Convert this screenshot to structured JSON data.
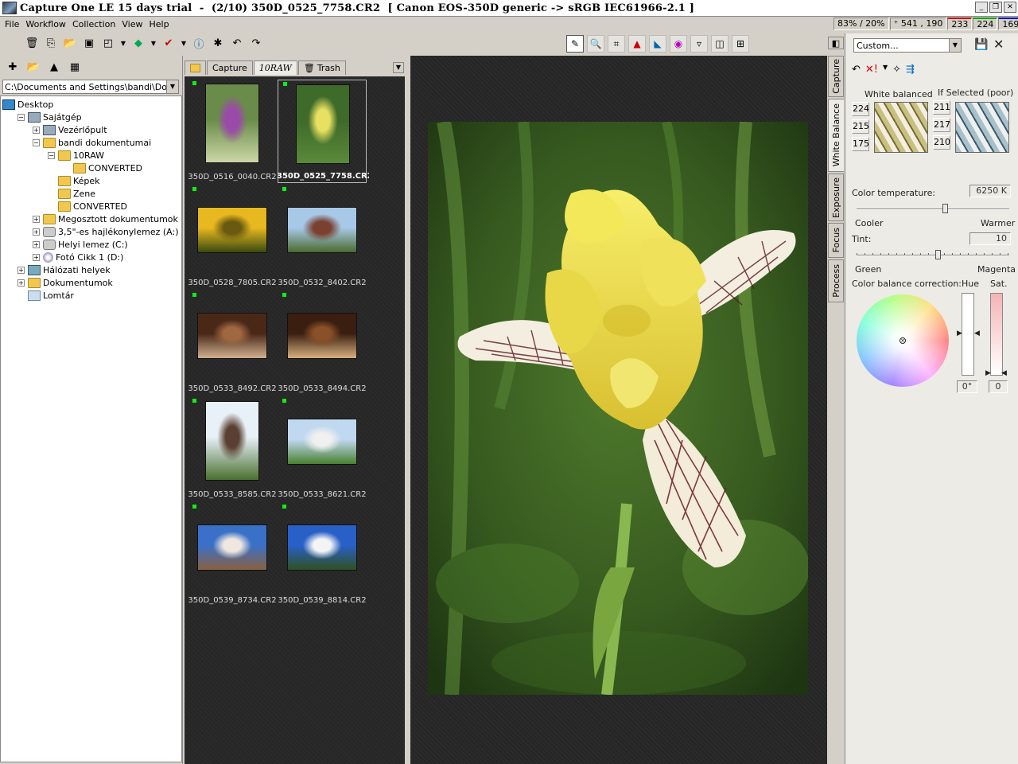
{
  "window": {
    "title": "Capture One LE 15 days trial  -  (2/10) 350D_0525_7758.CR2  [ Canon EOS-350D generic -> sRGB IEC61966-2.1 ]"
  },
  "menu": [
    "File",
    "Workflow",
    "Collection",
    "View",
    "Help"
  ],
  "status": {
    "zoom": "83% / 20%",
    "coords": "541 , 190",
    "r": "233",
    "g": "224",
    "b": "169"
  },
  "folder_path": "C:\\Documents and Settings\\bandi\\Dokumentumai",
  "tree": [
    {
      "label": "Desktop",
      "indent": 0,
      "expander": "",
      "icon": "desk"
    },
    {
      "label": "Sajátgép",
      "indent": 1,
      "expander": "−",
      "icon": "pc"
    },
    {
      "label": "Vezérlőpult",
      "indent": 2,
      "expander": "+",
      "icon": "pc"
    },
    {
      "label": "bandi dokumentumai",
      "indent": 2,
      "expander": "−",
      "icon": "folder"
    },
    {
      "label": "10RAW",
      "indent": 3,
      "expander": "−",
      "icon": "folder"
    },
    {
      "label": "CONVERTED",
      "indent": 4,
      "expander": "",
      "icon": "folder"
    },
    {
      "label": "Képek",
      "indent": 3,
      "expander": "",
      "icon": "folder"
    },
    {
      "label": "Zene",
      "indent": 3,
      "expander": "",
      "icon": "folder"
    },
    {
      "label": "CONVERTED",
      "indent": 3,
      "expander": "",
      "icon": "folder"
    },
    {
      "label": "Megosztott dokumentumok",
      "indent": 2,
      "expander": "+",
      "icon": "folder"
    },
    {
      "label": "3,5\"-es hajlékonylemez (A:)",
      "indent": 2,
      "expander": "+",
      "icon": "drive"
    },
    {
      "label": "Helyi lemez (C:)",
      "indent": 2,
      "expander": "+",
      "icon": "drive"
    },
    {
      "label": "Fotó Cikk 1 (D:)",
      "indent": 2,
      "expander": "+",
      "icon": "cd"
    },
    {
      "label": "Hálózati helyek",
      "indent": 1,
      "expander": "+",
      "icon": "net"
    },
    {
      "label": "Dokumentumok",
      "indent": 1,
      "expander": "+",
      "icon": "folder"
    },
    {
      "label": "Lomtár",
      "indent": 1,
      "expander": "",
      "icon": "bin"
    }
  ],
  "tabs": {
    "capture": "Capture",
    "raw": "10RAW",
    "trash": "Trash"
  },
  "thumbnails": [
    {
      "file": "350D_0516_0040.CR2",
      "orient": "p",
      "colors": [
        "#6a8c4a",
        "#9a4aa8",
        "#cdd6a8"
      ],
      "selected": false
    },
    {
      "file": "350D_0525_7758.CR2",
      "orient": "p",
      "colors": [
        "#3e6a2a",
        "#e8e060",
        "#5a8a3a"
      ],
      "selected": true
    },
    {
      "file": "350D_0528_7805.CR2",
      "orient": "l",
      "colors": [
        "#e8b820",
        "#6a5a10",
        "#3a4a10"
      ],
      "selected": false
    },
    {
      "file": "350D_0532_8402.CR2",
      "orient": "l",
      "colors": [
        "#a8c8e8",
        "#7a4030",
        "#4a6a30"
      ],
      "selected": false
    },
    {
      "file": "350D_0533_8492.CR2",
      "orient": "l",
      "colors": [
        "#4a2818",
        "#a06840",
        "#d0b090"
      ],
      "selected": false
    },
    {
      "file": "350D_0533_8494.CR2",
      "orient": "l",
      "colors": [
        "#3a1e10",
        "#8a5028",
        "#d8b080"
      ],
      "selected": false
    },
    {
      "file": "350D_0533_8585.CR2",
      "orient": "p",
      "colors": [
        "#e8f0f8",
        "#5a4030",
        "#4a7030"
      ],
      "selected": false
    },
    {
      "file": "350D_0533_8621.CR2",
      "orient": "l",
      "colors": [
        "#c0d8f0",
        "#f0f0f0",
        "#4a8030"
      ],
      "selected": false
    },
    {
      "file": "350D_0539_8734.CR2",
      "orient": "l",
      "colors": [
        "#3a70c8",
        "#f0e8e0",
        "#8a6040"
      ],
      "selected": false
    },
    {
      "file": "350D_0539_8814.CR2",
      "orient": "l",
      "colors": [
        "#2860c8",
        "#f4f4f4",
        "#305020"
      ],
      "selected": false
    }
  ],
  "side_tabs": [
    "Capture",
    "White Balance",
    "Exposure",
    "Focus",
    "Process"
  ],
  "wb": {
    "preset": "Custom...",
    "wb_label": "White balanced",
    "ifsel_label": "If Selected (poor)",
    "left_vals": [
      "224",
      "215",
      "175"
    ],
    "right_vals": [
      "211",
      "217",
      "210"
    ],
    "temp_label": "Color temperature:",
    "temp_value": "6250 K",
    "temp_position": 0.58,
    "cooler": "Cooler",
    "warmer": "Warmer",
    "tint_label": "Tint:",
    "tint_value": "10",
    "tint_position": 0.53,
    "green": "Green",
    "magenta": "Magenta",
    "cbc_label": "Color balance correction:",
    "hue_label": "Hue",
    "sat_label": "Sat.",
    "hue_value": "0°",
    "sat_value": "0"
  }
}
